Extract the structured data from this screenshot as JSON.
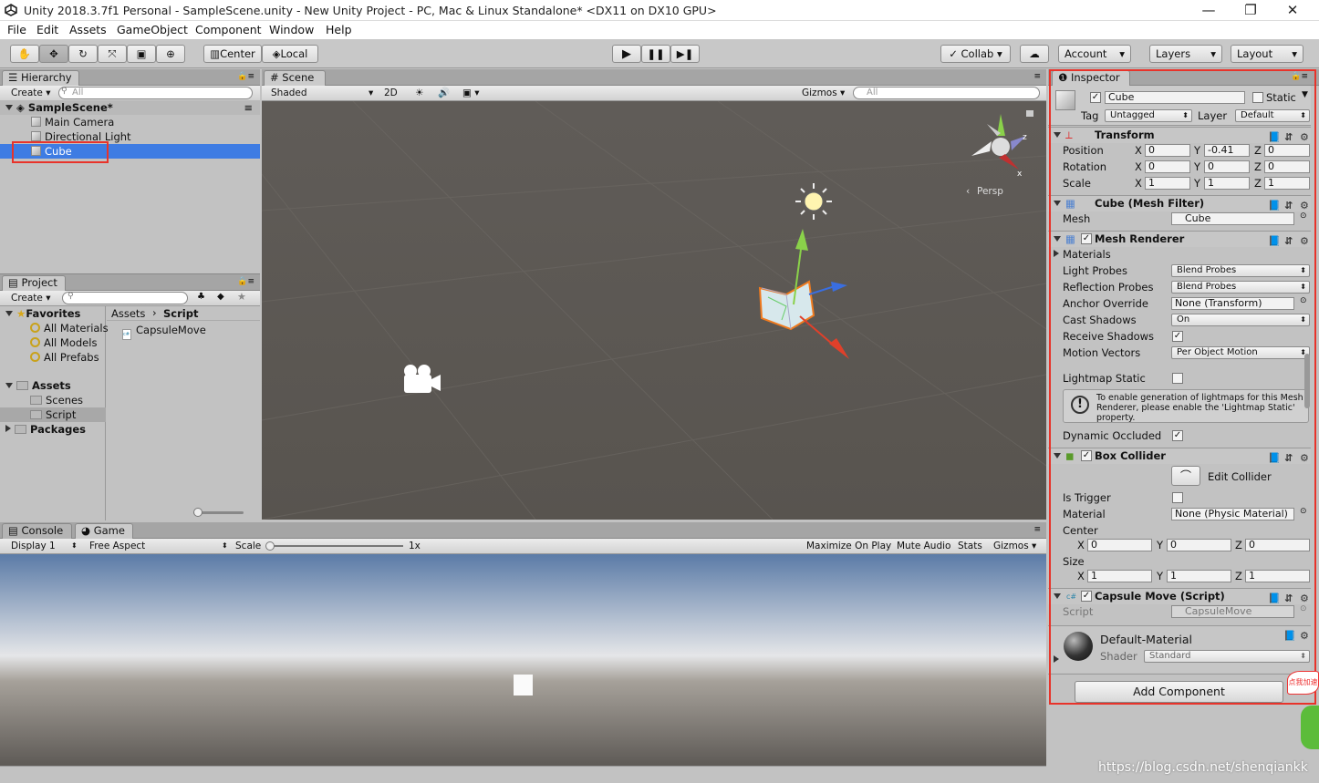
{
  "window": {
    "title": "Unity 2018.3.7f1 Personal - SampleScene.unity - New Unity Project - PC, Mac & Linux Standalone* <DX11 on DX10 GPU>",
    "minimize": "—",
    "maximize": "❐",
    "close": "✕"
  },
  "menu": [
    "File",
    "Edit",
    "Assets",
    "GameObject",
    "Component",
    "Window",
    "Help"
  ],
  "toolbar": {
    "center": "Center",
    "local": "Local",
    "collab": "Collab ▾",
    "account": "Account",
    "layers": "Layers",
    "layout": "Layout"
  },
  "hierarchy": {
    "tab": "Hierarchy",
    "create": "Create ▾",
    "search_placeholder": "All",
    "scene": "SampleScene*",
    "items": [
      "Main Camera",
      "Directional Light",
      "Cube"
    ]
  },
  "project": {
    "tab": "Project",
    "create": "Create ▾",
    "favorites": "Favorites",
    "fav_items": [
      "All Materials",
      "All Models",
      "All Prefabs"
    ],
    "assets": "Assets",
    "asset_items": [
      "Scenes",
      "Script"
    ],
    "packages": "Packages",
    "breadcrumb_root": "Assets",
    "breadcrumb_leaf": "Script",
    "files": [
      "CapsuleMove"
    ]
  },
  "scene": {
    "tab": "Scene",
    "shaded": "Shaded",
    "mode2d": "2D",
    "gizmos": "Gizmos ▾",
    "search_placeholder": "All",
    "persp": "Persp"
  },
  "game": {
    "console_tab": "Console",
    "game_tab": "Game",
    "display": "Display 1",
    "aspect": "Free Aspect",
    "scale_label": "Scale",
    "scale_value": "1x",
    "maximize": "Maximize On Play",
    "mute": "Mute Audio",
    "stats": "Stats",
    "gizmos": "Gizmos ▾"
  },
  "inspector": {
    "tab": "Inspector",
    "object_name": "Cube",
    "static_label": "Static",
    "tag_label": "Tag",
    "tag_value": "Untagged",
    "layer_label": "Layer",
    "layer_value": "Default",
    "transform": {
      "title": "Transform",
      "position": "Position",
      "rotation": "Rotation",
      "scale": "Scale",
      "pos": [
        "0",
        "-0.41",
        "0"
      ],
      "rot": [
        "0",
        "0",
        "0"
      ],
      "scl": [
        "1",
        "1",
        "1"
      ],
      "x": "X",
      "y": "Y",
      "z": "Z"
    },
    "mesh_filter": {
      "title": "Cube (Mesh Filter)",
      "mesh_label": "Mesh",
      "mesh_value": "Cube"
    },
    "mesh_renderer": {
      "title": "Mesh Renderer",
      "materials": "Materials",
      "rows": [
        {
          "label": "Light Probes",
          "value": "Blend Probes"
        },
        {
          "label": "Reflection Probes",
          "value": "Blend Probes"
        },
        {
          "label": "Anchor Override",
          "value": "None (Transform)"
        },
        {
          "label": "Cast Shadows",
          "value": "On"
        },
        {
          "label": "Receive Shadows",
          "value": ""
        },
        {
          "label": "Motion Vectors",
          "value": "Per Object Motion"
        }
      ],
      "lightmap_static": "Lightmap Static",
      "warning": "To enable generation of lightmaps for this Mesh Renderer, please enable the 'Lightmap Static' property.",
      "dynamic_occluded": "Dynamic Occluded"
    },
    "box_collider": {
      "title": "Box Collider",
      "edit": "Edit Collider",
      "is_trigger": "Is Trigger",
      "material_label": "Material",
      "material_value": "None (Physic Material)",
      "center": "Center",
      "center_vals": [
        "0",
        "0",
        "0"
      ],
      "size": "Size",
      "size_vals": [
        "1",
        "1",
        "1"
      ]
    },
    "capsule_move": {
      "title": "Capsule Move (Script)",
      "script_label": "Script",
      "script_value": "CapsuleMove"
    },
    "material": {
      "name": "Default-Material",
      "shader_label": "Shader",
      "shader_value": "Standard"
    },
    "add_component": "Add Component"
  },
  "watermark": "https://blog.csdn.net/shenqiankk",
  "badge": "点我加速",
  "colors": {
    "selection": "#3e7ce3",
    "highlight": "#e8332a",
    "scene_bg": "#5e5a56"
  }
}
